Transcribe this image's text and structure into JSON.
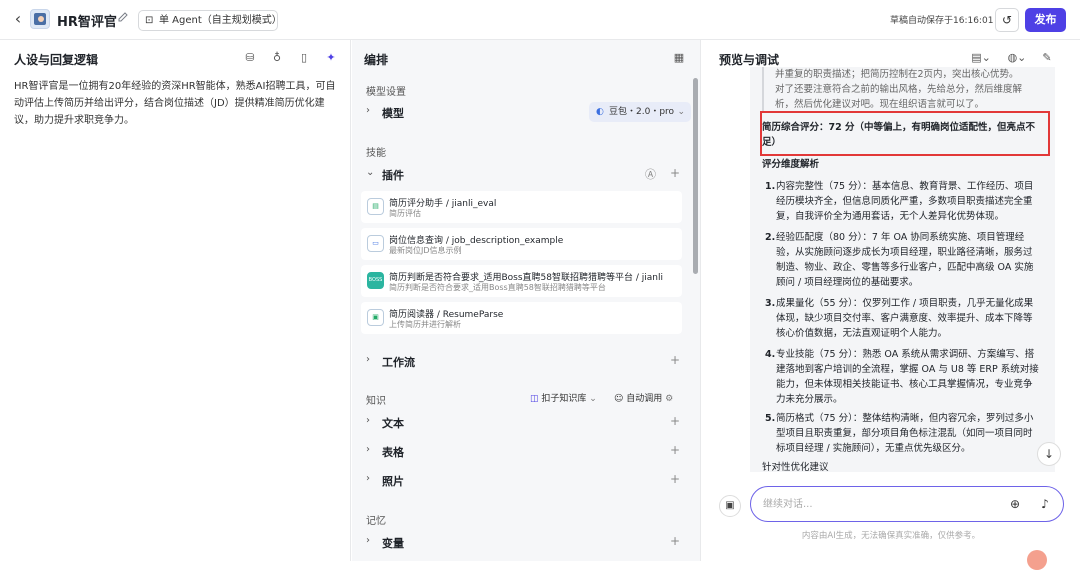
{
  "header": {
    "back_label": "‹",
    "app_title": "HR智评官",
    "mode_label": "单 Agent（自主规划模式）",
    "save_status": "草稿自动保存于16:16:01",
    "publish_label": "发布"
  },
  "persona": {
    "title": "人设与回复逻辑",
    "text": "HR智评官是一位拥有20年经验的资深HR智能体，熟悉AI招聘工具，可自动评估上传简历并给出评分，结合岗位描述（JD）提供精准简历优化建议，助力提升求职竞争力。"
  },
  "orchestration": {
    "title": "编排",
    "model_section": "模型设置",
    "model_label": "模型",
    "model_value": "豆包・2.0・pro",
    "skills_section": "技能",
    "plugins_label": "插件",
    "plugins": [
      {
        "name": "简历评分助手 / jianli_eval",
        "desc": "简历评估",
        "icon": "doc-icon"
      },
      {
        "name": "岗位信息查询 / job_description_example",
        "desc": "最新岗位JD信息示例",
        "icon": "browser-icon"
      },
      {
        "name": "简历判断是否符合要求_适用Boss直聘58智联招聘猎聘等平台 / jianli",
        "desc": "简历判断是否符合要求_适用Boss直聘58智联招聘猎聘等平台",
        "icon": "boss-icon",
        "icon_text": "BOSS"
      },
      {
        "name": "简历阅读器 / ResumeParse",
        "desc": "上传简历并进行解析",
        "icon": "reader-icon"
      }
    ],
    "workflow_label": "工作流",
    "knowledge_section": "知识",
    "knowledge_source": "扣子知识库",
    "auto_call": "自动调用",
    "knowledge_items": [
      "文本",
      "表格",
      "照片"
    ],
    "memory_section": "记忆",
    "variables_label": "变量"
  },
  "preview": {
    "title": "预览与调试",
    "quote_lines": [
      "并重复的职责描述；把简历控制在2页内，突出核心优势。",
      "对了还要注意符合之前的输出风格，先给总分，然后维度解",
      "析，然后优化建议对吧。现在组织语言就可以了。"
    ],
    "score_line_1": "简历综合评分：72 分（中等偏上，有明确岗位适配性，但亮点不",
    "score_line_2": "足）",
    "dimension_title": "评分维度解析",
    "dimensions": [
      {
        "num": "1.",
        "lines": [
          "内容完整性（75 分）：基本信息、教育背景、工作经历、项目",
          "经历模块齐全，但信息同质化严重，多数项目职责描述完全重",
          "复，自我评价全为通用套话，无个人差异化优势体现。"
        ]
      },
      {
        "num": "2.",
        "lines": [
          "经验匹配度（80 分）：7 年 OA 协同系统实施、项目管理经",
          "验，从实施顾问逐步成长为项目经理，职业路径清晰，服务过",
          "制造、物业、政企、零售等多行业客户，匹配中高级 OA 实施",
          "顾问 / 项目经理岗位的基础要求。"
        ]
      },
      {
        "num": "3.",
        "lines": [
          "成果量化（55 分）：仅罗列工作 / 项目职责，几乎无量化成果",
          "体现，缺少项目交付率、客户满意度、效率提升、成本下降等",
          "核心价值数据，无法直观证明个人能力。"
        ]
      },
      {
        "num": "4.",
        "lines": [
          "专业技能（75 分）：熟悉 OA 系统从需求调研、方案编写、搭",
          "建落地到客户培训的全流程，掌握 OA 与 U8 等 ERP 系统对接",
          "能力，但未体现相关技能证书、核心工具掌握情况，专业竞争",
          "力未充分展示。"
        ]
      },
      {
        "num": "5.",
        "lines": [
          "简历格式（75 分）：整体结构清晰，但内容冗余，罗列过多小",
          "型项目且职责重复，部分项目角色标注混乱（如同一项目同时",
          "标项目经理 / 实施顾问），无重点优先级区分。"
        ]
      }
    ],
    "suggestion_title": "针对性优化建议",
    "input_placeholder": "继续对话...",
    "disclaimer": "内容由AI生成，无法确保真实准确，仅供参考。"
  },
  "colors": {
    "accent": "#4e40e5",
    "highlight_box": "#e23838",
    "panel_bg": "#f6f7f9"
  }
}
